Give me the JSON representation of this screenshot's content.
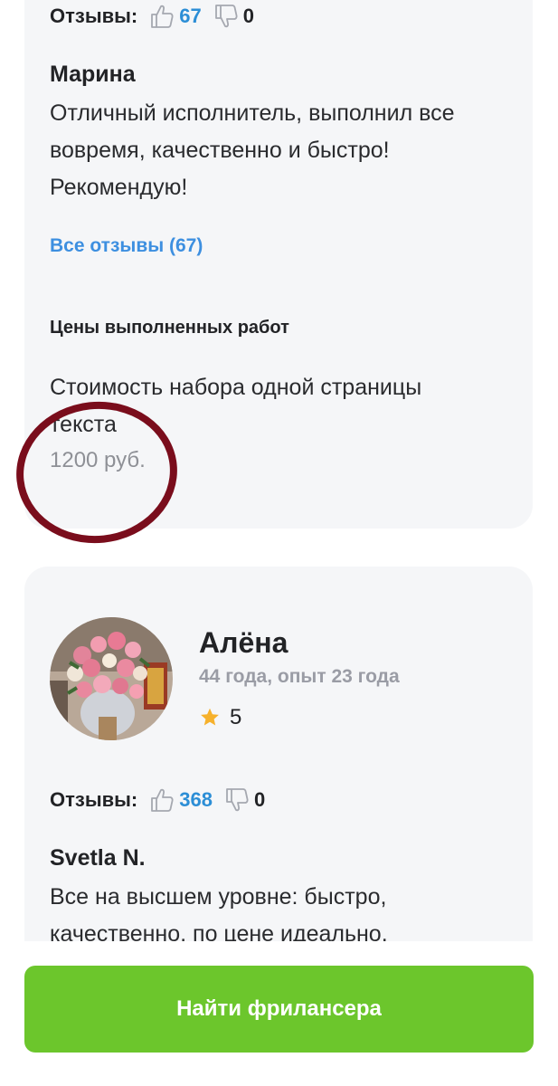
{
  "card1": {
    "reviews": {
      "label": "Отзывы:",
      "likes": "67",
      "dislikes": "0"
    },
    "review": {
      "author": "Марина",
      "lines": [
        "Отличный исполнитель, выполнил все",
        "вовремя, качественно и быстро!",
        "Рекомендую!"
      ]
    },
    "all_reviews_link": "Все отзывы (67)",
    "prices": {
      "title": "Цены выполненных работ",
      "service_lines": [
        "Стоимость набора одной страницы",
        "текста"
      ],
      "value": "1200 руб."
    }
  },
  "card2": {
    "profile": {
      "name": "Алёна",
      "meta": "44 года, опыт 23 года",
      "rating": "5"
    },
    "reviews": {
      "label": "Отзывы:",
      "likes": "368",
      "dislikes": "0"
    },
    "review": {
      "author": "Svetla N.",
      "lines": [
        "Все на высшем уровне: быстро,",
        "качественно, по цене идеально."
      ]
    }
  },
  "cta": {
    "label": "Найти фрилансера"
  },
  "colors": {
    "accent_link": "#3d8fe0",
    "likes": "#2c8ed6",
    "cta": "#6cc62c",
    "highlight_circle": "#7a0d1c",
    "star": "#f6b12c"
  },
  "icons": {
    "like": "thumbs-up-icon",
    "dislike": "thumbs-down-icon",
    "rating": "star-icon"
  }
}
